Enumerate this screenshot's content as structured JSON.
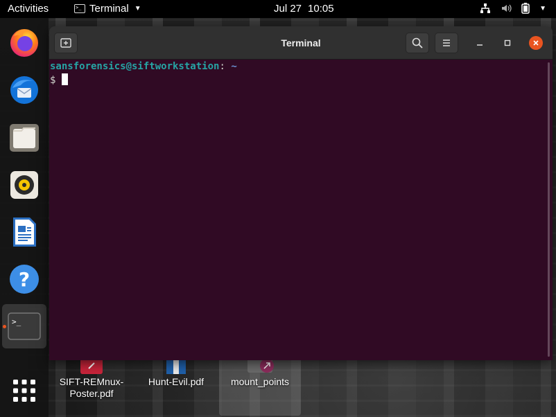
{
  "topbar": {
    "activities": "Activities",
    "app_name": "Terminal",
    "date": "Jul 27",
    "time": "10:05"
  },
  "dock": {
    "items": [
      {
        "name": "firefox-icon",
        "label": "Firefox"
      },
      {
        "name": "thunderbird-icon",
        "label": "Thunderbird"
      },
      {
        "name": "files-icon",
        "label": "Files"
      },
      {
        "name": "rhythmbox-icon",
        "label": "Rhythmbox"
      },
      {
        "name": "libreoffice-writer-icon",
        "label": "LibreOffice Writer"
      },
      {
        "name": "help-icon",
        "label": "Help"
      },
      {
        "name": "terminal-icon",
        "label": "Terminal"
      },
      {
        "name": "show-apps-icon",
        "label": "Show Applications"
      }
    ]
  },
  "desktop": {
    "icons": [
      {
        "line1": "SIFT-REMnux-",
        "line2": "Poster.pdf"
      },
      {
        "line1": "Hunt-Evil.pdf"
      },
      {
        "line1": "mount_points"
      }
    ]
  },
  "window": {
    "title": "Terminal",
    "prompt_user": "sansforensics@siftworkstation",
    "prompt_sep": ":",
    "prompt_path": "~",
    "prompt_symbol": "$"
  },
  "colors": {
    "terminal_bg": "#300a24",
    "accent": "#e95420",
    "prompt_user": "#26a4a4"
  }
}
